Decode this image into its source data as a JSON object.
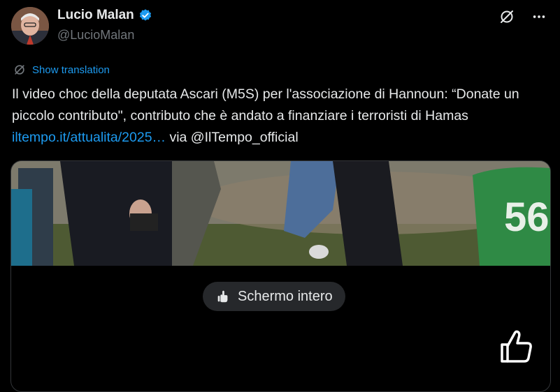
{
  "author": {
    "name": "Lucio Malan",
    "handle": "@LucioMalan",
    "verified": true
  },
  "actions": {
    "grok_icon": "slashed-circle-icon",
    "more_icon": "more-horizontal-icon"
  },
  "translate": {
    "label": "Show translation"
  },
  "tweet": {
    "text_1": "Il video choc della deputata Ascari (M5S) per l'associazione di Hannoun: “Donate un piccolo contributo\", contributo che è andato a finanziare i terroristi di Hamas ",
    "link": "iltempo.it/attualita/2025…",
    "text_2": " via @IlTempo_official"
  },
  "media": {
    "fullscreen_label": "Schermo intero",
    "jersey_number": "56"
  },
  "colors": {
    "accent": "#1d9bf0",
    "background": "#000000",
    "text": "#e7e9ea",
    "muted": "#71767b"
  }
}
